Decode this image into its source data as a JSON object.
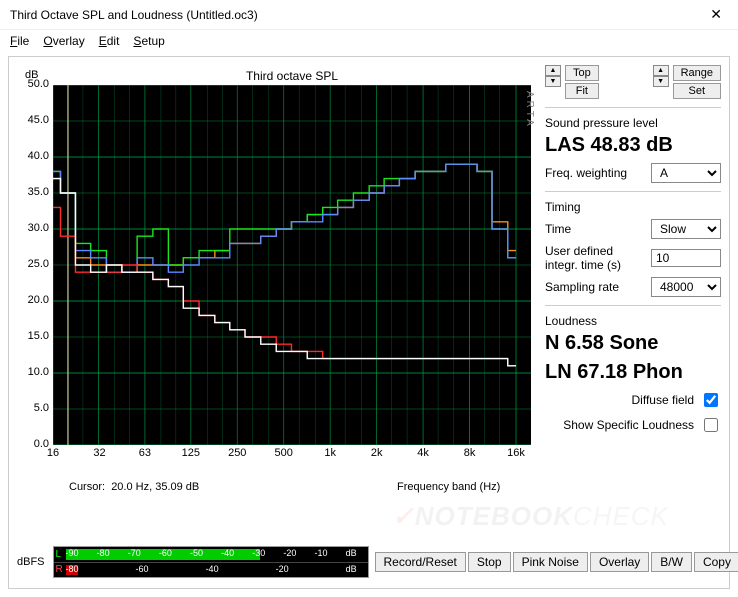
{
  "window": {
    "title": "Third Octave SPL and Loudness (Untitled.oc3)",
    "close_icon": "✕"
  },
  "menu": {
    "file": "File",
    "overlay": "Overlay",
    "edit": "Edit",
    "setup": "Setup"
  },
  "chart": {
    "title": "Third octave SPL",
    "ylabel": "dB",
    "xlabel": "Frequency band (Hz)",
    "arta": "ARTA",
    "cursor_label": "Cursor:",
    "cursor_value": "20.0 Hz, 35.09 dB"
  },
  "side": {
    "top_btn": "Top",
    "fit_btn": "Fit",
    "range_btn": "Range",
    "set_btn": "Set",
    "spl_label": "Sound pressure level",
    "spl_value": "LAS 48.83 dB",
    "freq_weight_label": "Freq. weighting",
    "freq_weight_value": "A",
    "timing_label": "Timing",
    "time_label": "Time",
    "time_value": "Slow",
    "intgr_label": "User defined integr. time (s)",
    "intgr_value": "10",
    "samp_label": "Sampling rate",
    "samp_value": "48000",
    "loud_label": "Loudness",
    "loud_n": "N 6.58 Sone",
    "loud_ln": "LN 67.18 Phon",
    "diffuse_label": "Diffuse field",
    "showspec_label": "Show Specific Loudness"
  },
  "bottom": {
    "meters_label": "dBFS",
    "btns": {
      "record": "Record/Reset",
      "stop": "Stop",
      "pink": "Pink Noise",
      "overlay": "Overlay",
      "bw": "B/W",
      "copy": "Copy"
    },
    "ticks_L": [
      "-90",
      "-80",
      "-70",
      "-60",
      "-50",
      "-40",
      "-30",
      "-20",
      "-10",
      "dB"
    ],
    "ticks_R": [
      "-80",
      "-60",
      "-40",
      "-20",
      "dB"
    ]
  },
  "chart_data": {
    "type": "line",
    "xlabel": "Frequency band (Hz)",
    "ylabel": "dB",
    "ylim": [
      0,
      50
    ],
    "x_ticks": [
      16,
      32,
      63,
      125,
      250,
      500,
      "1k",
      "2k",
      "4k",
      "8k",
      "16k"
    ],
    "y_ticks": [
      0,
      5,
      10,
      15,
      20,
      25,
      30,
      35,
      40,
      45,
      50
    ],
    "x_values_hz": [
      16,
      20,
      25,
      31.5,
      40,
      50,
      63,
      80,
      100,
      125,
      160,
      200,
      250,
      315,
      400,
      500,
      630,
      800,
      1000,
      1250,
      1600,
      2000,
      2500,
      3150,
      4000,
      5000,
      6300,
      8000,
      10000,
      12500,
      16000
    ],
    "series": [
      {
        "name": "orange",
        "color": "#ff8c1a",
        "values": [
          37,
          35,
          26,
          25,
          25,
          24,
          25,
          25,
          25,
          26,
          26,
          27,
          28,
          28,
          29,
          30,
          31,
          32,
          32,
          33,
          34,
          35,
          36,
          37,
          38,
          38,
          39,
          39,
          38,
          31,
          27
        ]
      },
      {
        "name": "green",
        "color": "#1ae61a",
        "values": [
          38,
          35,
          28,
          27,
          24,
          24,
          29,
          30,
          25,
          26,
          27,
          27,
          30,
          30,
          30,
          30,
          31,
          32,
          33,
          34,
          35,
          36,
          37,
          37,
          38,
          38,
          39,
          39,
          38,
          30,
          26
        ]
      },
      {
        "name": "blue",
        "color": "#5a8cff",
        "values": [
          38,
          35,
          27,
          26,
          24,
          24,
          26,
          25,
          24,
          25,
          26,
          26,
          28,
          28,
          29,
          30,
          31,
          31,
          32,
          33,
          34,
          35,
          36,
          37,
          38,
          38,
          39,
          39,
          38,
          30,
          26
        ]
      },
      {
        "name": "red",
        "color": "#ff2a2a",
        "values": [
          33,
          29,
          24,
          24,
          24,
          25,
          24,
          23,
          22,
          20,
          18,
          17,
          16,
          15,
          15,
          14,
          13,
          13,
          12,
          12,
          12,
          12,
          12,
          12,
          12,
          12,
          12,
          12,
          12,
          12,
          11
        ]
      },
      {
        "name": "white",
        "color": "#ffffff",
        "values": [
          37,
          35,
          25,
          24,
          25,
          24,
          24,
          23,
          22,
          19,
          18,
          17,
          16,
          15,
          14,
          13,
          13,
          12,
          12,
          12,
          12,
          12,
          12,
          12,
          12,
          12,
          12,
          12,
          12,
          12,
          11
        ]
      }
    ]
  }
}
